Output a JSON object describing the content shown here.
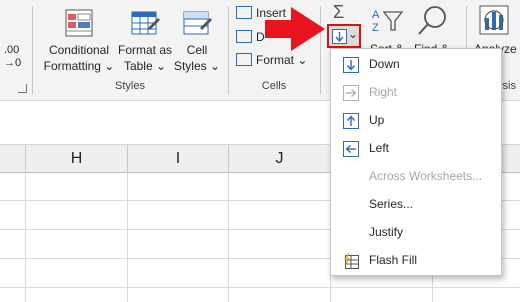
{
  "ribbon": {
    "left_value": ".00",
    "left_value2": "→0",
    "conditional_formatting": [
      "Conditional",
      "Formatting ⌄"
    ],
    "format_as_table": [
      "Format as",
      "Table ⌄"
    ],
    "cell_styles": [
      "Cell",
      "Styles ⌄"
    ],
    "styles_group": "Styles",
    "insert": "Insert",
    "delete_partial": "D",
    "format": "Format",
    "cells_group": "Cells",
    "sort_partial": "Sort &",
    "find_partial": "Find &",
    "analyze_partial": "Analyze",
    "analysis_partial": "ysis",
    "fill_chevron": "⌄"
  },
  "sheet": {
    "columns": [
      "H",
      "I",
      "J"
    ]
  },
  "fill_menu": {
    "items": [
      {
        "label": "Down",
        "icon": "fill-down-icon",
        "enabled": true
      },
      {
        "label": "Right",
        "icon": "fill-right-icon",
        "enabled": false
      },
      {
        "label": "Up",
        "icon": "fill-up-icon",
        "enabled": true
      },
      {
        "label": "Left",
        "icon": "fill-left-icon",
        "enabled": true
      },
      {
        "label": "Across Worksheets...",
        "icon": "",
        "enabled": false
      },
      {
        "label": "Series...",
        "icon": "",
        "enabled": true
      },
      {
        "label": "Justify",
        "icon": "",
        "enabled": true
      },
      {
        "label": "Flash Fill",
        "icon": "flash-fill-icon",
        "enabled": true
      }
    ]
  },
  "colors": {
    "arrow_red": "#e8141e",
    "icon_blue": "#2a6ebb",
    "highlight_border": "#e01010"
  }
}
